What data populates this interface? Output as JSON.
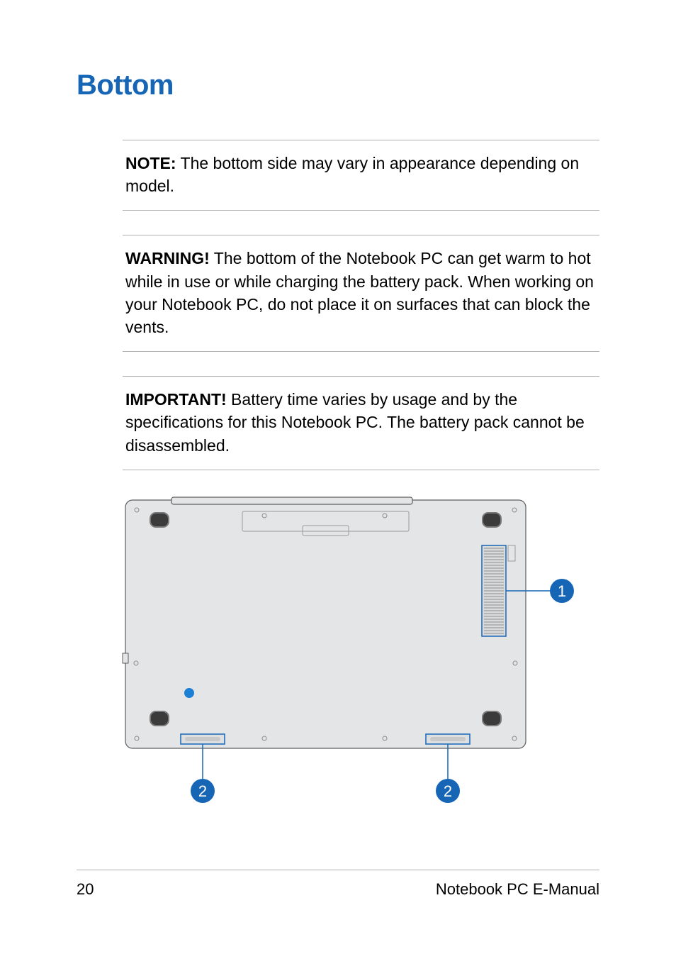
{
  "title": "Bottom",
  "note": {
    "label": "NOTE:",
    "text": " The bottom side may vary in appearance depending on model."
  },
  "warning": {
    "label": "WARNING!",
    "text": " The bottom of the Notebook PC can get warm to hot while in use or while charging the battery pack. When working on your Notebook PC, do not place it on surfaces that can block the vents."
  },
  "important": {
    "label": "IMPORTANT!",
    "text": " Battery time varies by usage and by the specifications for this Notebook PC. The battery pack cannot be disassembled."
  },
  "callouts": {
    "c1": "1",
    "c2a": "2",
    "c2b": "2"
  },
  "footer": {
    "page": "20",
    "doc": "Notebook PC E-Manual"
  },
  "colors": {
    "accent": "#1766b6"
  }
}
